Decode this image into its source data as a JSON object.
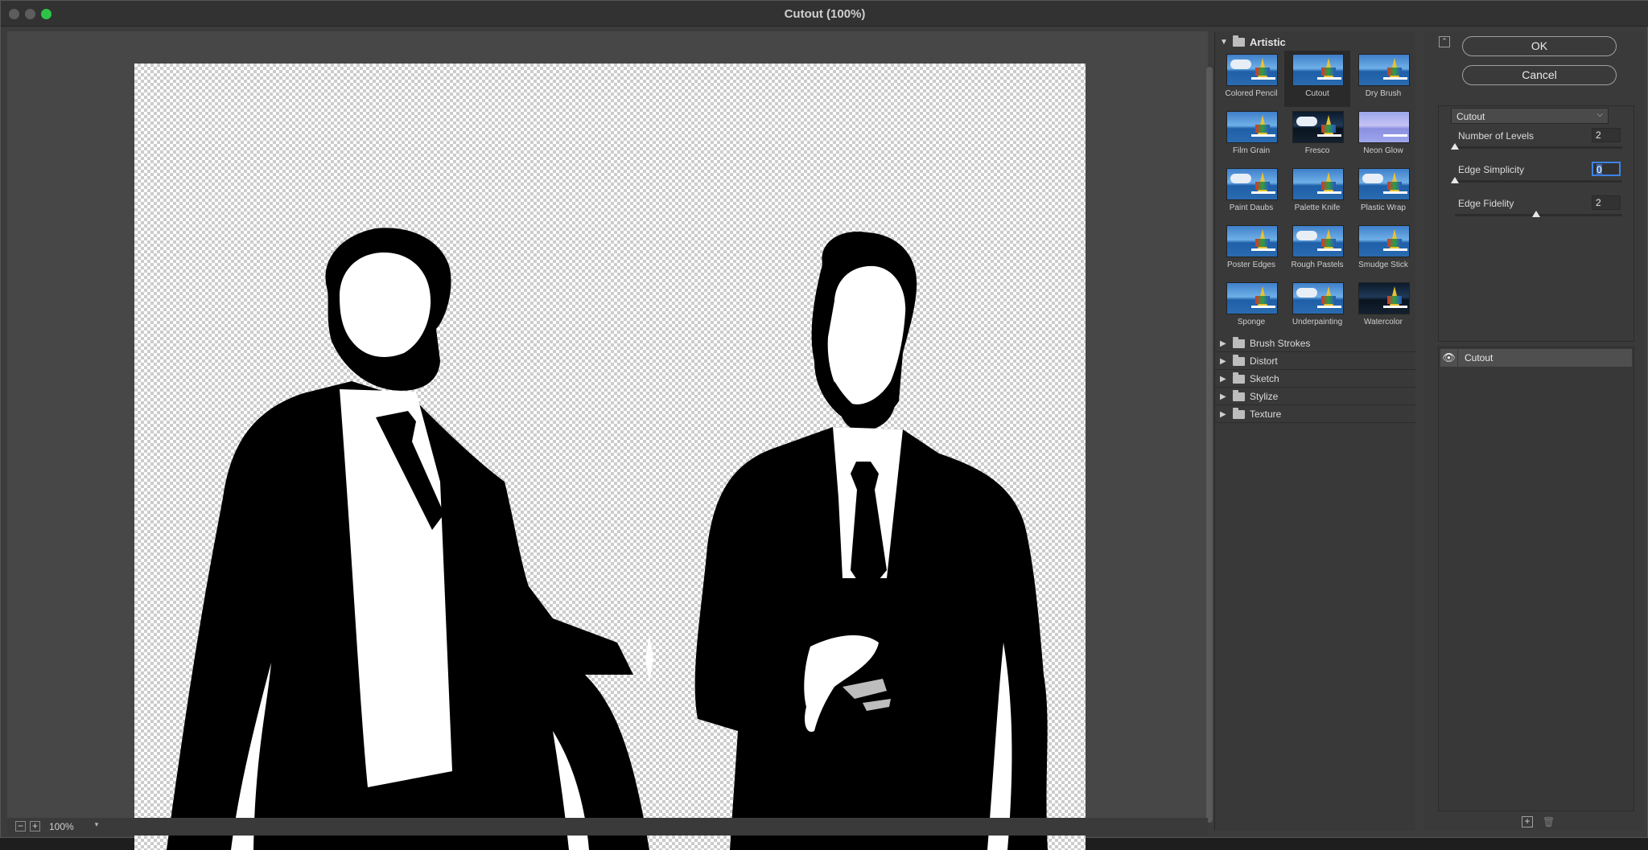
{
  "window": {
    "title": "Cutout (100%)"
  },
  "status": {
    "zoom": "100%",
    "zoom_out": "−",
    "zoom_in": "+"
  },
  "gallery": {
    "open_category": "Artistic",
    "filters": [
      {
        "label": "Colored Pencil"
      },
      {
        "label": "Cutout",
        "selected": true
      },
      {
        "label": "Dry Brush"
      },
      {
        "label": "Film Grain"
      },
      {
        "label": "Fresco"
      },
      {
        "label": "Neon Glow"
      },
      {
        "label": "Paint Daubs"
      },
      {
        "label": "Palette Knife"
      },
      {
        "label": "Plastic Wrap"
      },
      {
        "label": "Poster Edges"
      },
      {
        "label": "Rough Pastels"
      },
      {
        "label": "Smudge Stick"
      },
      {
        "label": "Sponge"
      },
      {
        "label": "Underpainting"
      },
      {
        "label": "Watercolor"
      }
    ],
    "categories": [
      {
        "label": "Brush Strokes"
      },
      {
        "label": "Distort"
      },
      {
        "label": "Sketch"
      },
      {
        "label": "Stylize"
      },
      {
        "label": "Texture"
      }
    ]
  },
  "panel": {
    "ok": "OK",
    "cancel": "Cancel",
    "filter_select": "Cutout",
    "params": [
      {
        "label": "Number of Levels",
        "value": "2",
        "level": 0.0
      },
      {
        "label": "Edge Simplicity",
        "value": "0",
        "level": 0.0
      },
      {
        "label": "Edge Fidelity",
        "value": "2",
        "level": 0.33
      }
    ],
    "layer": "Cutout"
  }
}
